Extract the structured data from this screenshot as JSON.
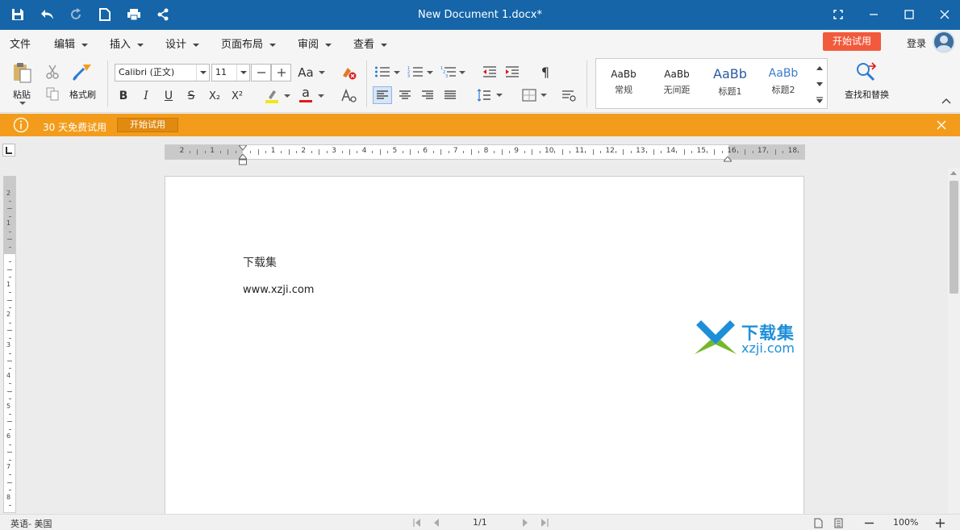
{
  "titlebar": {
    "title": "New Document 1.docx*"
  },
  "menu": {
    "items": [
      {
        "label": "文件",
        "has_caret": false
      },
      {
        "label": "编辑",
        "has_caret": true
      },
      {
        "label": "插入",
        "has_caret": true
      },
      {
        "label": "设计",
        "has_caret": true
      },
      {
        "label": "页面布局",
        "has_caret": true
      },
      {
        "label": "审阅",
        "has_caret": true
      },
      {
        "label": "查看",
        "has_caret": true
      }
    ],
    "trial_button": "开始试用",
    "login": "登录"
  },
  "ribbon": {
    "paste_label": "粘贴",
    "format_painter_label": "格式刷",
    "font_name": "Calibri (正文)",
    "font_size": "11",
    "font_case": "Aa",
    "bold": "B",
    "italic": "I",
    "underline": "U",
    "strike": "S",
    "subscript": "X₂",
    "superscript": "X²",
    "font_color_letter": "a",
    "styles": [
      {
        "sample": "AaBb",
        "name": "常规"
      },
      {
        "sample": "AaBb",
        "name": "无间距"
      },
      {
        "sample": "AaBb",
        "name": "标题1"
      },
      {
        "sample": "AaBb",
        "name": "标题2"
      }
    ],
    "find_replace_label": "查找和替换",
    "pilcrow": "¶",
    "colors": {
      "highlight": "#f5e516",
      "font_color": "#e0191b",
      "accent": "#1565a8"
    }
  },
  "notice": {
    "text": "30 天免费试用",
    "button": "开始试用"
  },
  "ruler": {
    "h_labels": [
      "2",
      "1",
      "1",
      "2",
      "3",
      "4",
      "5",
      "6",
      "7",
      "8",
      "9",
      "10",
      "11",
      "12",
      "13",
      "14",
      "15",
      "16",
      "17",
      "18"
    ],
    "v_labels": [
      "2",
      "1",
      "1",
      "2",
      "3",
      "4",
      "5",
      "6",
      "7",
      "8",
      "9",
      "10"
    ]
  },
  "document": {
    "lines": [
      "下载集",
      "www.xzji.com"
    ],
    "watermark": {
      "cn": "下载集",
      "url": "xzji.com"
    }
  },
  "statusbar": {
    "language": "英语- 美国",
    "page": "1/1",
    "zoom": "100%"
  }
}
